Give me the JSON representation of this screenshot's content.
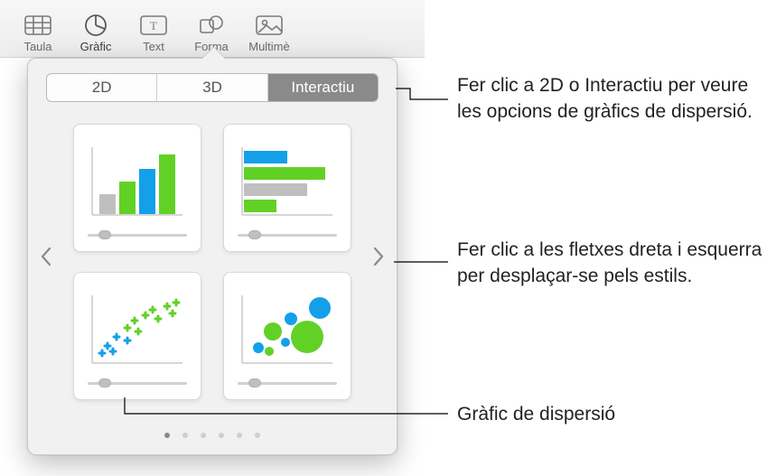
{
  "toolbar": {
    "items": [
      {
        "id": "taula",
        "label": "Taula"
      },
      {
        "id": "grafic",
        "label": "Gràfic"
      },
      {
        "id": "text",
        "label": "Text"
      },
      {
        "id": "forma",
        "label": "Forma"
      },
      {
        "id": "multim",
        "label": "Multimè"
      }
    ],
    "active": "grafic"
  },
  "popover": {
    "tabs": {
      "d2": "2D",
      "d3": "3D",
      "interactive": "Interactiu"
    },
    "selected_tab": "interactive",
    "charts": [
      {
        "id": "vertical-bars",
        "name": "vertical-bars-chart"
      },
      {
        "id": "horizontal-bars",
        "name": "horizontal-bars-chart"
      },
      {
        "id": "scatter",
        "name": "scatter-chart"
      },
      {
        "id": "bubble",
        "name": "bubble-chart"
      }
    ],
    "page_dots": 6,
    "page_index": 0
  },
  "palette": {
    "green": "#62d126",
    "blue": "#13a0e8",
    "grey": "#bfbfbf"
  },
  "callouts": {
    "tabs": "Fer clic a 2D o Interactiu per veure les opcions de gràfics de dispersió.",
    "arrows": "Fer clic a les fletxes dreta i esquerra per desplaçar-se pels estils.",
    "scatter": "Gràfic de dispersió"
  }
}
